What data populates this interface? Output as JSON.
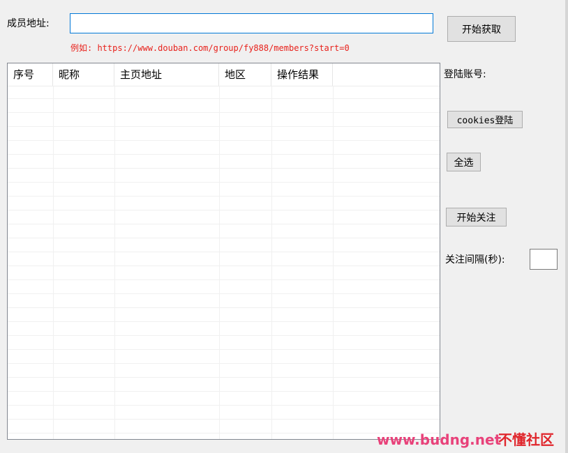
{
  "form": {
    "member_url_label": "成员地址:",
    "member_url_value": "",
    "example_text": "例如: https://www.douban.com/group/fy888/members?start=0",
    "fetch_button": "开始获取"
  },
  "table": {
    "columns": [
      "序号",
      "昵称",
      "主页地址",
      "地区",
      "操作结果"
    ],
    "rows": []
  },
  "right_panel": {
    "login_account_label": "登陆账号:",
    "cookies_login_button": "cookies登陆",
    "select_all_button": "全选",
    "start_follow_button": "开始关注",
    "interval_label": "关注间隔(秒):",
    "interval_value": ""
  },
  "watermark": {
    "site": "www.budng.net",
    "name": "不懂社区"
  },
  "colors": {
    "example_text": "#e8211b",
    "input_focus_border": "#0078d7",
    "watermark_site": "#e8427a",
    "watermark_name": "#e0262c"
  }
}
